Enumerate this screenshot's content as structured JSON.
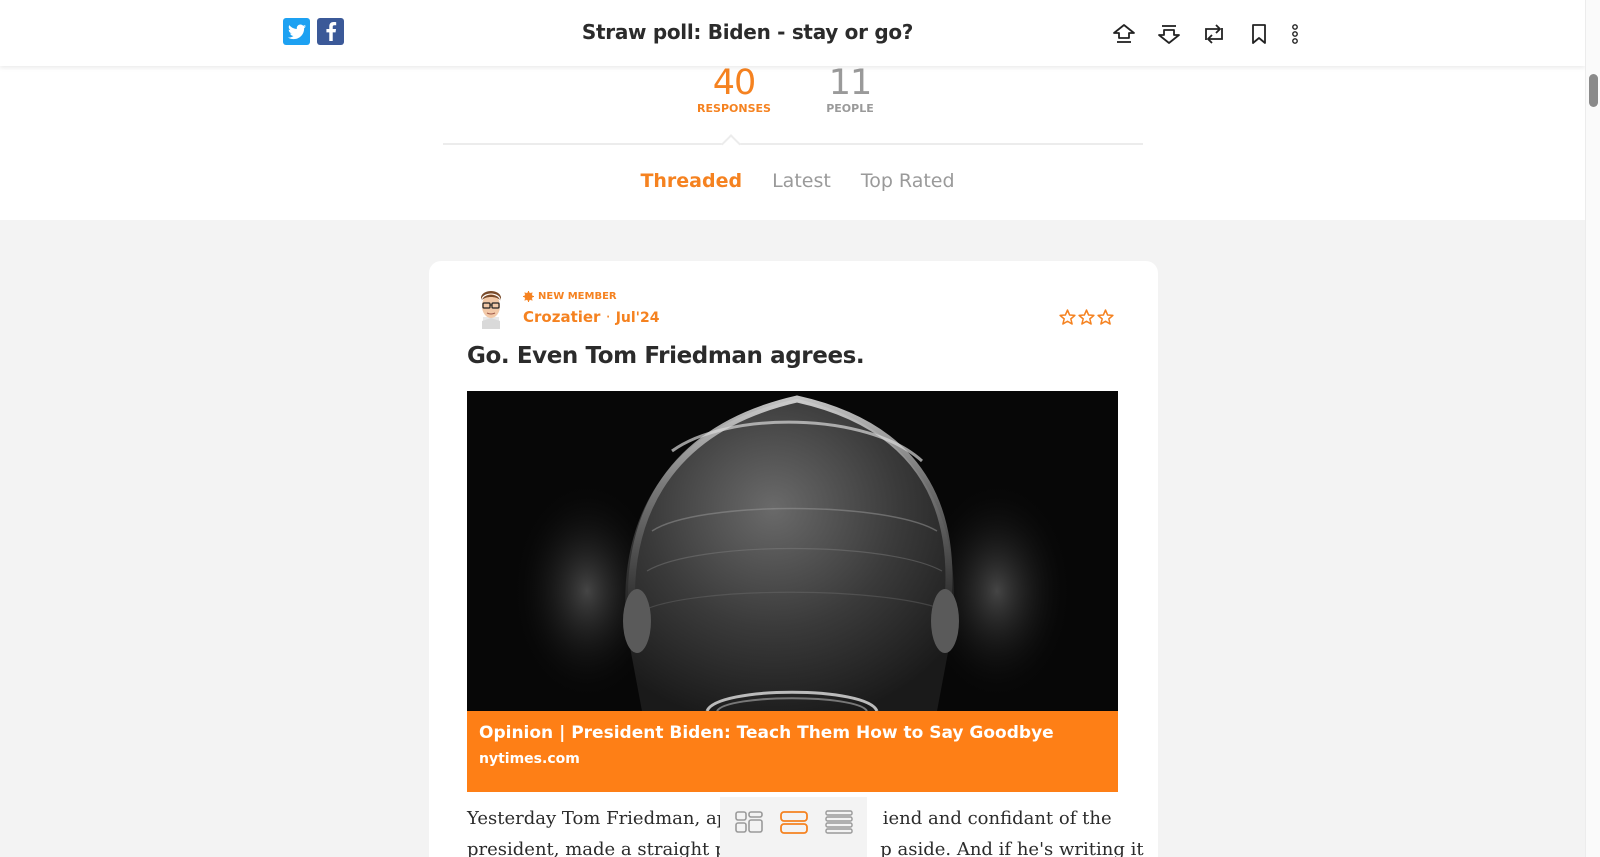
{
  "header": {
    "title": "Straw poll: Biden - stay or go?",
    "share": {
      "twitter_icon": "twitter-icon",
      "facebook_icon": "facebook-icon"
    },
    "tools": [
      "upvote-icon",
      "downvote-icon",
      "repost-icon",
      "bookmark-icon",
      "more-icon"
    ]
  },
  "stats": {
    "responses": {
      "value": "40",
      "label": "RESPONSES"
    },
    "people": {
      "value": "11",
      "label": "PEOPLE"
    }
  },
  "tabs": [
    {
      "label": "Threaded",
      "active": true
    },
    {
      "label": "Latest",
      "active": false
    },
    {
      "label": "Top Rated",
      "active": false
    }
  ],
  "post": {
    "badge": "NEW MEMBER",
    "author": "Crozatier",
    "separator": "·",
    "date": "Jul'24",
    "rating_stars": 3,
    "title": "Go. Even Tom Friedman agrees.",
    "link": {
      "title": "Opinion | President Biden: Teach Them How to Say Goodbye",
      "domain": "nytimes.com"
    },
    "body_line1": "Yesterday Tom Friedman, app                         iend and confidant of the",
    "body_line2": "president, made a straight ple                        p aside. And if he's writing it"
  },
  "view_modes": [
    "grid-view-icon",
    "card-view-icon",
    "list-view-icon"
  ],
  "colors": {
    "accent": "#f58220",
    "banner": "#fe7f16",
    "muted": "#9a9a9a"
  }
}
